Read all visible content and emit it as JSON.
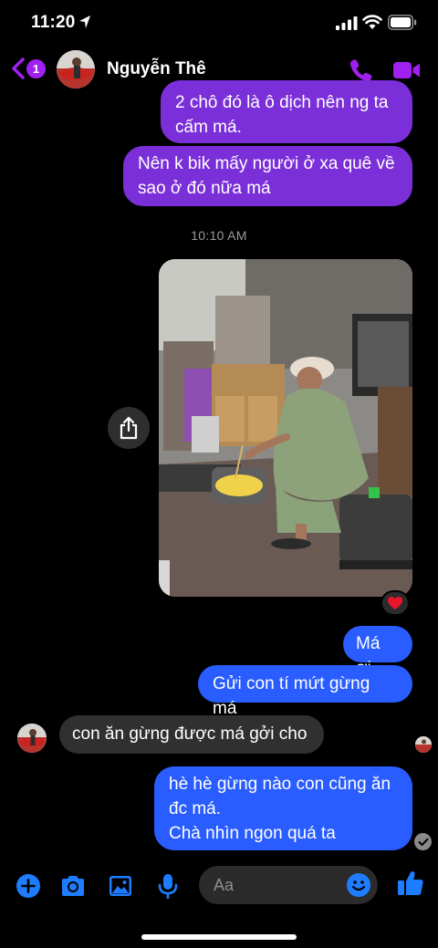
{
  "status_bar": {
    "time": "11:20",
    "icons": [
      "location-arrow-icon",
      "signal-icon",
      "wifi-icon",
      "battery-icon"
    ]
  },
  "header": {
    "back_badge": "1",
    "contact_name": "Nguyễn Thê",
    "icons": [
      "back-chevron-icon",
      "phone-icon",
      "video-camera-icon"
    ]
  },
  "colors": {
    "accent": "#a020f0",
    "sent_purple": "#7b2fd8",
    "sent_blue": "#2a5dff",
    "received_gray": "#303030",
    "icon_blue": "#1e7dff"
  },
  "messages": [
    {
      "id": "m1",
      "side": "sent",
      "lines": [
        "2 chô đó là ô dịch nên ng ta",
        "cấm má."
      ]
    },
    {
      "id": "m2",
      "side": "sent",
      "lines": [
        "Nên k bik mấy người ở xa quê về",
        "sao ở đó nữa má"
      ]
    },
    {
      "id": "ts",
      "type": "timestamp",
      "text": "10:10 AM"
    },
    {
      "id": "m3",
      "side": "sent",
      "type": "photo",
      "reaction": "heart"
    },
    {
      "id": "m4",
      "side": "sent",
      "lines": [
        "Má ơi"
      ]
    },
    {
      "id": "m5",
      "side": "sent",
      "lines": [
        "Gửi con tí mứt gừng má"
      ]
    },
    {
      "id": "m6",
      "side": "received",
      "lines": [
        "con ăn gừng được má gởi cho"
      ]
    },
    {
      "id": "m7",
      "side": "sent",
      "lines": [
        "hè hè gừng nào con cũng ăn",
        "đc má.",
        "Chà nhìn ngon quá ta"
      ]
    }
  ],
  "composer": {
    "placeholder": "Aa",
    "icons": [
      "plus-icon",
      "camera-icon",
      "image-icon",
      "microphone-icon",
      "emoji-icon",
      "thumbs-up-icon"
    ]
  }
}
